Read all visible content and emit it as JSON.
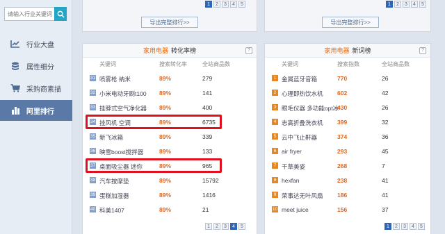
{
  "search": {
    "placeholder": "请输入行业关键词"
  },
  "nav": [
    {
      "label": "行业大盘"
    },
    {
      "label": "属性细分"
    },
    {
      "label": "采购商素描"
    },
    {
      "label": "阿里排行"
    }
  ],
  "top_left": {
    "pages": [
      "1",
      "2",
      "3",
      "4",
      "5"
    ],
    "active_page": "1",
    "export_label": "导出完整排行>>"
  },
  "top_right": {
    "pages": [
      "1",
      "2",
      "3",
      "4",
      "5"
    ],
    "active_page": "1",
    "export_label": "导出完整排行>>"
  },
  "left_panel": {
    "category": "家用电器",
    "title": "转化率榜",
    "help": "?",
    "headers": [
      "关键词",
      "搜索转化率",
      "全站商品数"
    ],
    "rows": [
      {
        "rank": "31",
        "keyword": "喷雾枪 纳米",
        "rate": "89%",
        "count": "279"
      },
      {
        "rank": "32",
        "keyword": "小米电动牙刷t100",
        "rate": "89%",
        "count": "141"
      },
      {
        "rank": "33",
        "keyword": "挂脖式空气净化器",
        "rate": "89%",
        "count": "400"
      },
      {
        "rank": "34",
        "keyword": "挂风机 空调",
        "rate": "89%",
        "count": "6735"
      },
      {
        "rank": "35",
        "keyword": "新飞冰箱",
        "rate": "89%",
        "count": "339"
      },
      {
        "rank": "36",
        "keyword": "映雪boost搅拌器",
        "rate": "89%",
        "count": "133"
      },
      {
        "rank": "37",
        "keyword": "桌面吸尘器 迷你",
        "rate": "89%",
        "count": "965"
      },
      {
        "rank": "38",
        "keyword": "汽车按摩垫",
        "rate": "89%",
        "count": "15792"
      },
      {
        "rank": "39",
        "keyword": "蛋糕加湿器",
        "rate": "89%",
        "count": "1416"
      },
      {
        "rank": "40",
        "keyword": "科美1407",
        "rate": "89%",
        "count": "21"
      }
    ],
    "pages": [
      "1",
      "2",
      "3",
      "4",
      "5"
    ],
    "active_page": "4"
  },
  "right_panel": {
    "category": "家用电器",
    "title": "新词榜",
    "help": "?",
    "headers": [
      "关键词",
      "搜索指数",
      "全站商品数"
    ],
    "rows": [
      {
        "rank": "1",
        "keyword": "金属蓝牙音箱",
        "index": "770",
        "count": "26"
      },
      {
        "rank": "2",
        "keyword": "心理即热饮水机",
        "index": "602",
        "count": "42"
      },
      {
        "rank": "3",
        "keyword": "眼毛仪器 多功能opt冰",
        "index": "430",
        "count": "26"
      },
      {
        "rank": "4",
        "keyword": "志高折叠洗衣机",
        "index": "399",
        "count": "32"
      },
      {
        "rank": "5",
        "keyword": "云中飞止鼾器",
        "index": "374",
        "count": "36"
      },
      {
        "rank": "6",
        "keyword": "air fryer",
        "index": "293",
        "count": "45"
      },
      {
        "rank": "7",
        "keyword": "干草美姿",
        "index": "268",
        "count": "7"
      },
      {
        "rank": "8",
        "keyword": "hexfan",
        "index": "238",
        "count": "41"
      },
      {
        "rank": "9",
        "keyword": "荣事达无叶风扇",
        "index": "186",
        "count": "41"
      },
      {
        "rank": "10",
        "keyword": "meet juice",
        "index": "156",
        "count": "37"
      }
    ],
    "pages": [
      "1",
      "2",
      "3",
      "4",
      "5"
    ],
    "active_page": "1"
  },
  "colors": {
    "accent": "#e3651b",
    "nav_active": "#5a79a6",
    "rank_blue": "#7f9fd0",
    "rank_orange": "#e8871e",
    "highlight": "#e0111e"
  }
}
